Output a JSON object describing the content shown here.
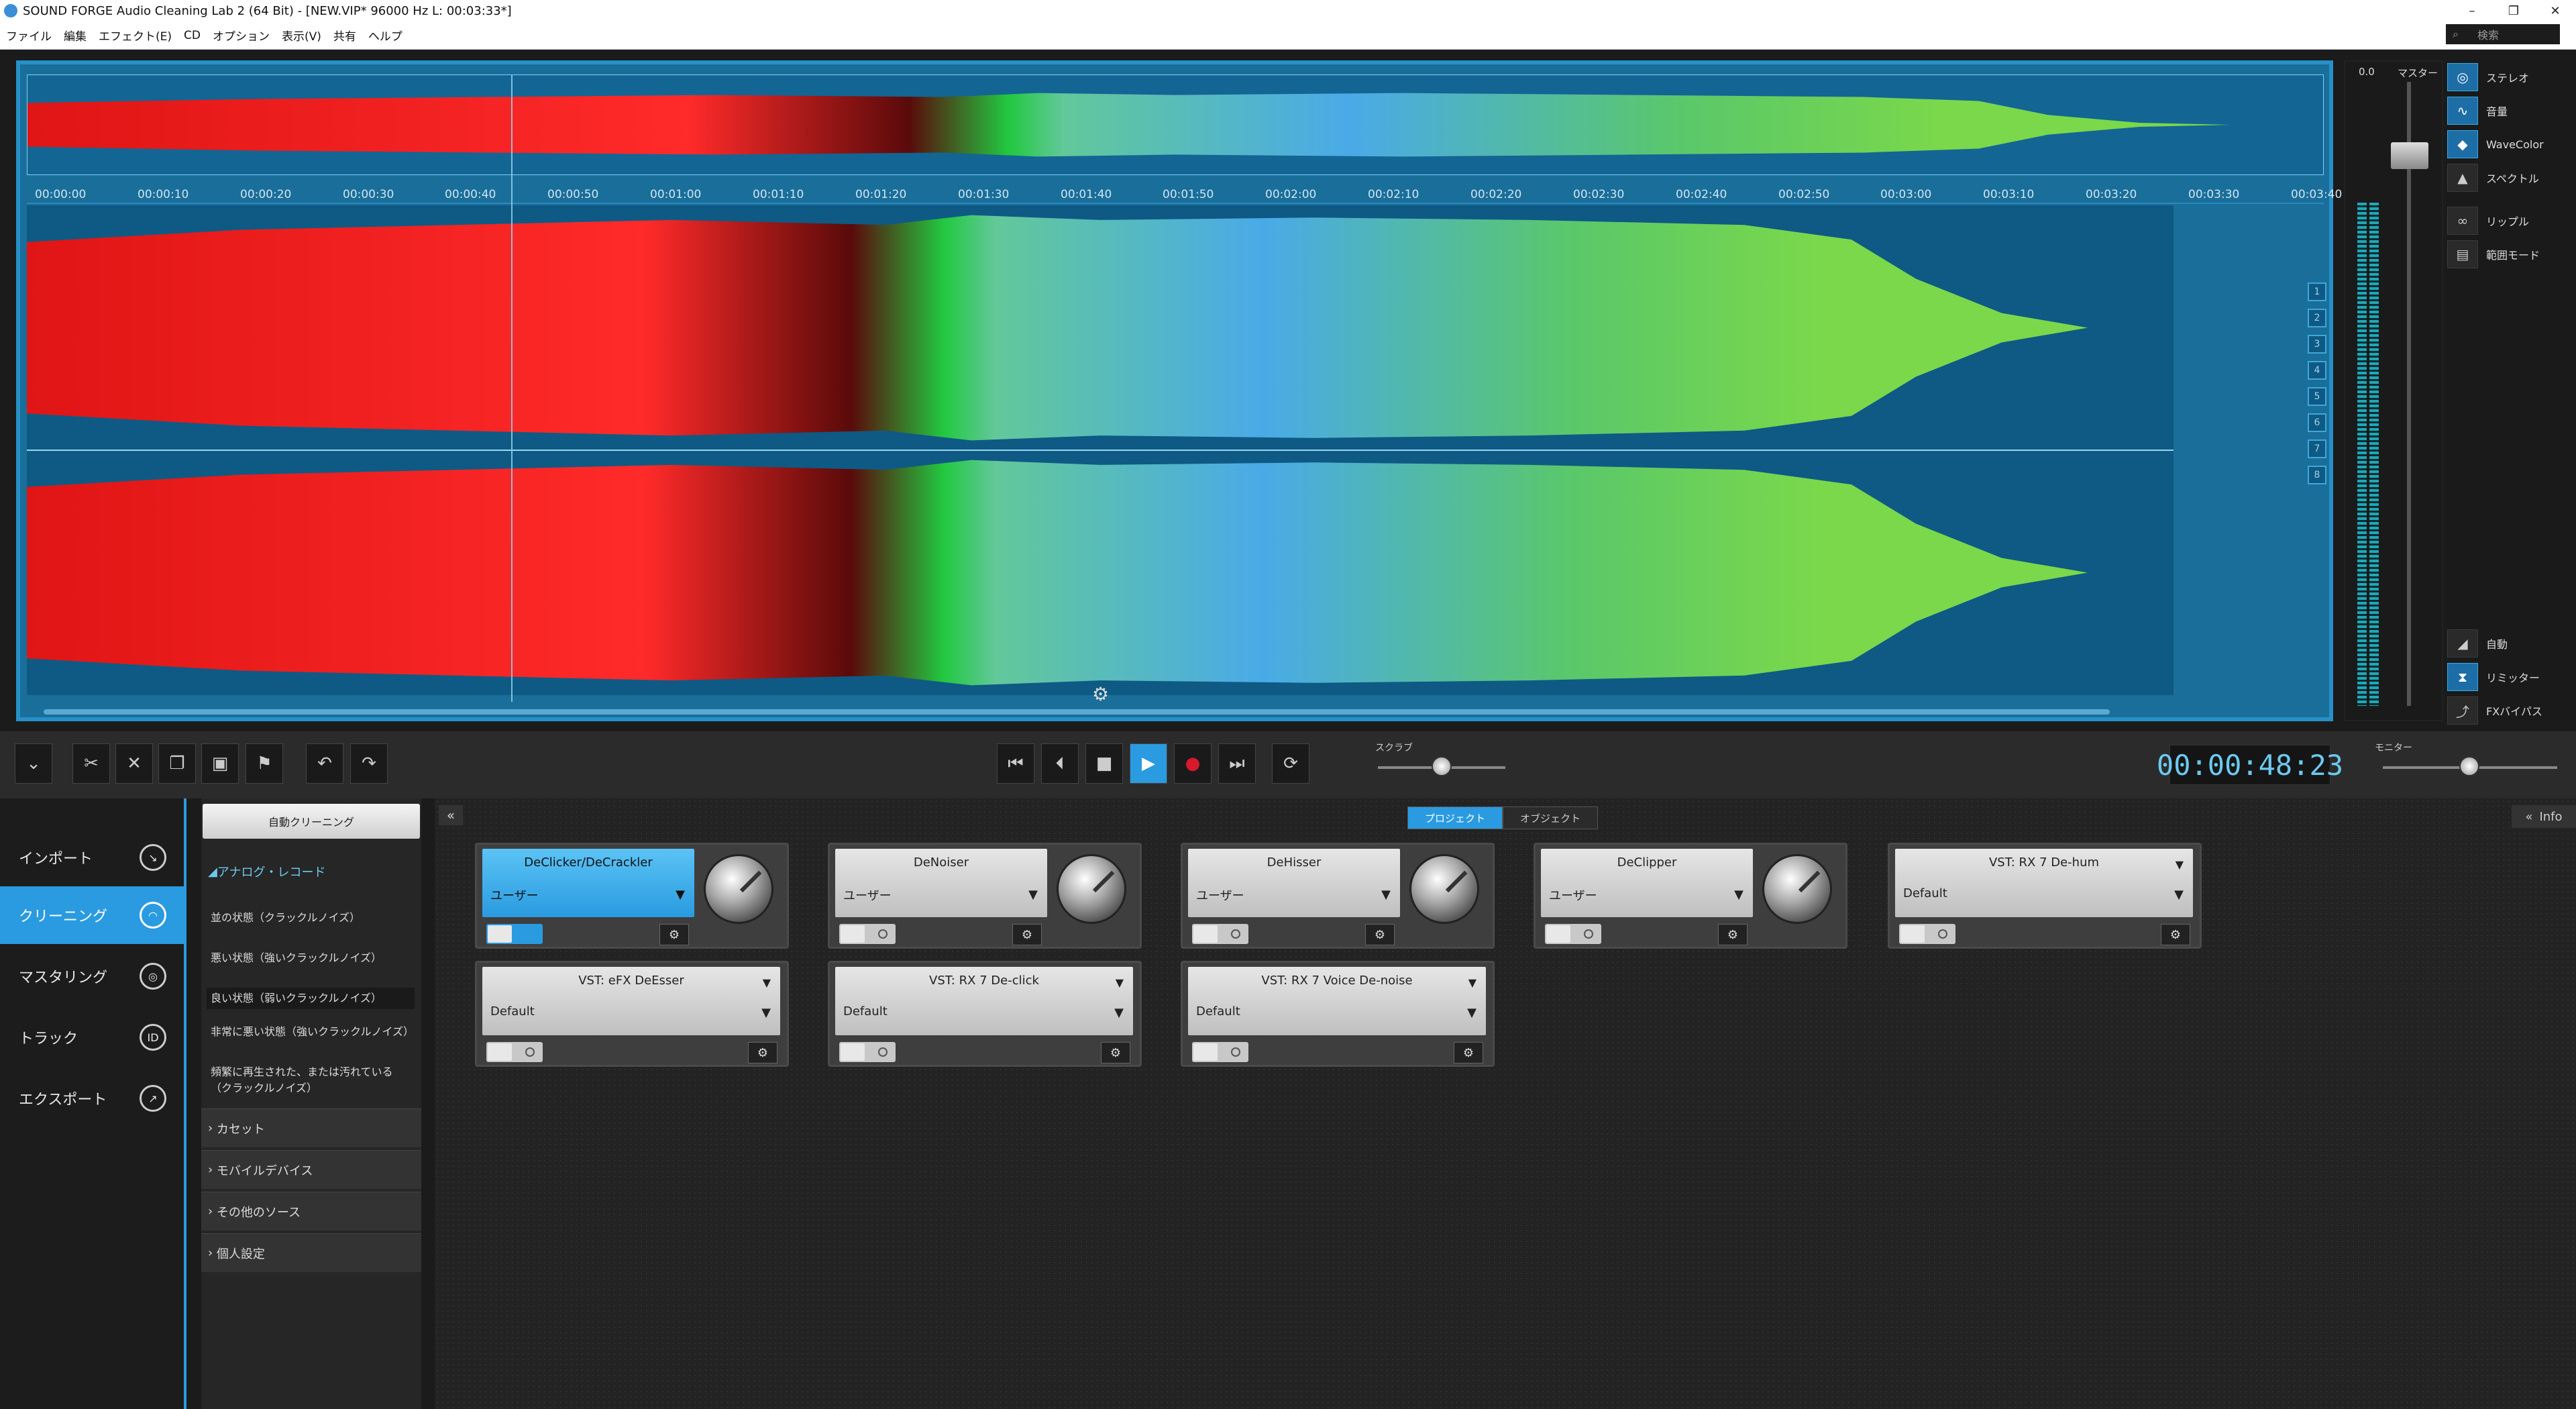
{
  "titlebar": {
    "title": "SOUND FORGE Audio Cleaning Lab 2 (64 Bit) - [NEW.VIP*   96000 Hz L: 00:03:33*]",
    "minimize": "–",
    "restore": "❐",
    "close": "✕"
  },
  "menu": {
    "items": [
      "ファイル",
      "編集",
      "エフェクト(E)",
      "CD",
      "オプション",
      "表示(V)",
      "共有",
      "ヘルプ"
    ],
    "search_placeholder": "検索"
  },
  "ruler": {
    "ticks": [
      "00:00:00",
      "00:00:10",
      "00:00:20",
      "00:00:30",
      "00:00:40",
      "00:00:50",
      "00:01:00",
      "00:01:10",
      "00:01:20",
      "00:01:30",
      "00:01:40",
      "00:01:50",
      "00:02:00",
      "00:02:10",
      "00:02:20",
      "00:02:30",
      "00:02:40",
      "00:02:50",
      "00:03:00",
      "00:03:10",
      "00:03:20",
      "00:03:30",
      "00:03:40"
    ]
  },
  "channel_buttons": [
    "1",
    "2",
    "3",
    "4",
    "5",
    "6",
    "7",
    "8"
  ],
  "meters": {
    "peak": "0.0",
    "master_label": "マスター"
  },
  "view_panel": {
    "items": [
      {
        "label": "ステレオ",
        "icon": "stereo-icon",
        "active": true
      },
      {
        "label": "音量",
        "icon": "volume-icon",
        "active": true
      },
      {
        "label": "WaveColor",
        "icon": "wavecolor-icon",
        "active": true
      },
      {
        "label": "スペクトル",
        "icon": "spectrum-icon",
        "active": false
      },
      {
        "label": "リップル",
        "icon": "ripple-icon",
        "active": false
      },
      {
        "label": "範囲モード",
        "icon": "range-mode-icon",
        "active": false
      }
    ],
    "bottom_items": [
      {
        "label": "自動",
        "icon": "auto-icon",
        "active": false
      },
      {
        "label": "リミッター",
        "icon": "limiter-icon",
        "active": true
      },
      {
        "label": "FXバイパス",
        "icon": "fx-bypass-icon",
        "active": false
      }
    ]
  },
  "transport": {
    "scrub_label": "スクラブ",
    "monitor_label": "モニター",
    "timecode": "00:00:48:23"
  },
  "sidebar": {
    "items": [
      {
        "label": "インポート",
        "icon": "import-icon",
        "glyph": "↘"
      },
      {
        "label": "クリーニング",
        "icon": "cleaning-icon",
        "glyph": "◠",
        "active": true
      },
      {
        "label": "マスタリング",
        "icon": "mastering-icon",
        "glyph": "◎"
      },
      {
        "label": "トラック",
        "icon": "track-icon",
        "glyph": "ID"
      },
      {
        "label": "エクスポート",
        "icon": "export-icon",
        "glyph": "↗"
      }
    ]
  },
  "presets": {
    "auto_clean": "自動クリーニング",
    "open_category": "アナログ・レコード",
    "items": [
      "並の状態（クラックルノイズ）",
      "悪い状態（強いクラックルノイズ）",
      "良い状態（弱いクラックルノイズ）",
      "非常に悪い状態（強いクラックルノイズ）",
      "頻繁に再生された、または汚れている（クラックルノイズ）"
    ],
    "categories": [
      "カセット",
      "モバイルデバイス",
      "その他のソース",
      "個人設定"
    ]
  },
  "plugins": {
    "tab_project": "プロジェクト",
    "tab_object": "オブジェクト",
    "info": "Info",
    "row1": [
      {
        "name": "DeClicker/DeCrackler",
        "value": "ユーザー",
        "active": true,
        "knob": true
      },
      {
        "name": "DeNoiser",
        "value": "ユーザー",
        "active": false,
        "knob": true
      },
      {
        "name": "DeHisser",
        "value": "ユーザー",
        "active": false,
        "knob": true
      },
      {
        "name": "DeClipper",
        "value": "ユーザー",
        "active": false,
        "knob": true
      },
      {
        "name": "VST: RX 7 De-hum",
        "value": "Default",
        "active": false,
        "knob": false
      }
    ],
    "row2": [
      {
        "name": "VST: eFX DeEsser",
        "value": "Default"
      },
      {
        "name": "VST: RX 7 De-click",
        "value": "Default"
      },
      {
        "name": "VST: RX 7 Voice De-noise",
        "value": "Default"
      }
    ]
  }
}
